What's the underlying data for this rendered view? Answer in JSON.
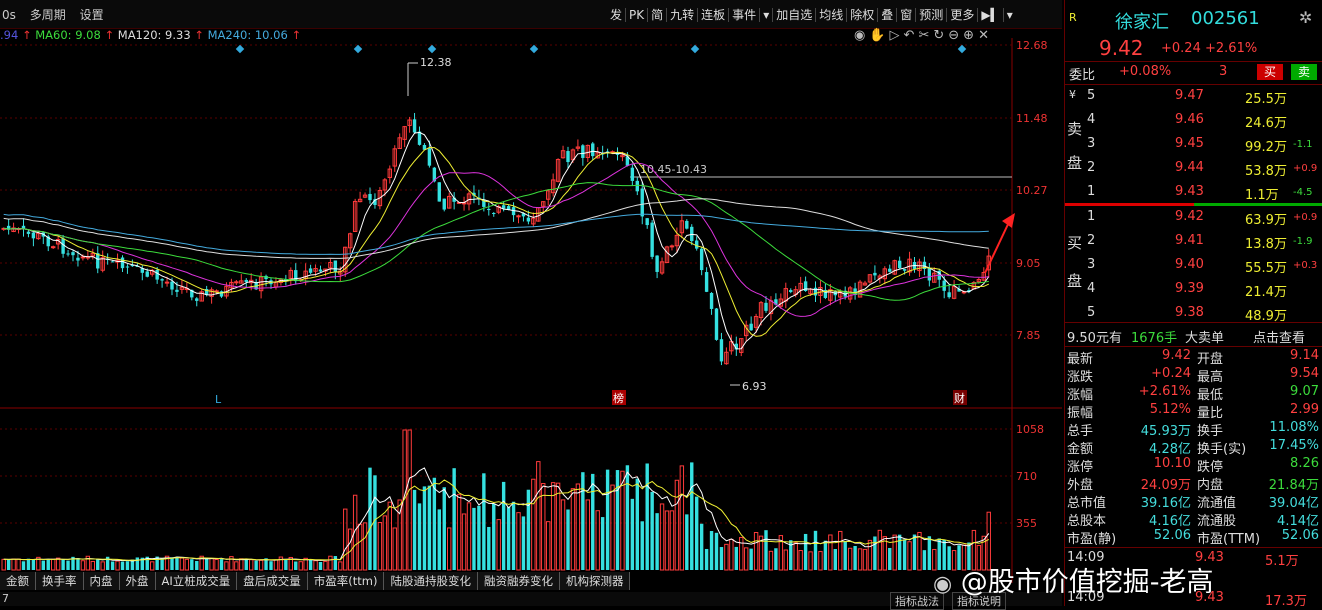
{
  "toolbar": {
    "left_items": [
      "0s",
      "多周期",
      "设置"
    ],
    "right_items": [
      "发",
      "PK",
      "简",
      "九转",
      "连板",
      "事件",
      "加自选",
      "均线",
      "除权",
      "叠",
      "窗",
      "预测",
      "更多"
    ]
  },
  "ma_legend": [
    {
      "text": ".94",
      "color": "#55d"
    },
    {
      "text": "MA60: 9.08",
      "color": "#3cdb3c"
    },
    {
      "text": "MA120: 9.33",
      "color": "#dddddd"
    },
    {
      "text": "MA240: 10.06",
      "color": "#4ad"
    }
  ],
  "chart": {
    "price_axis": [
      "12.68",
      "11.48",
      "10.27",
      "9.05",
      "7.85"
    ],
    "volume_axis": [
      "1058",
      "710",
      "355"
    ],
    "high_label": "12.38",
    "low_label": "6.93",
    "range_label": "10.45-10.43",
    "marks": [
      "L",
      "榜",
      "财"
    ],
    "colors": {
      "up": "#ff3b3b",
      "down": "#35e0e0",
      "grid": "#5a0000"
    }
  },
  "bottom_tabs": [
    "金额",
    "换手率",
    "内盘",
    "外盘",
    "AI立桩成交量",
    "盘后成交量",
    "市盈率(ttm)",
    "陆股通持股变化",
    "融资融券变化",
    "机构探测器"
  ],
  "status": {
    "left": "7",
    "tabs": [
      "指标战法",
      "指标说明"
    ]
  },
  "stock": {
    "badge": "R",
    "name": "徐家汇",
    "code": "002561",
    "price": "9.42",
    "change": "+0.24",
    "change_pct": "+2.61%"
  },
  "weibi": {
    "label": "委比",
    "value": "+0.08%",
    "count": "3",
    "buy": "买",
    "sell": "卖"
  },
  "sell_side_label": [
    "卖",
    "盘"
  ],
  "buy_side_label": [
    "买",
    "盘"
  ],
  "asks": [
    {
      "level": "5",
      "price": "9.47",
      "vol": "25.5万",
      "chg": ""
    },
    {
      "level": "4",
      "price": "9.46",
      "vol": "24.6万",
      "chg": ""
    },
    {
      "level": "3",
      "price": "9.45",
      "vol": "99.2万",
      "chg": "-1.1"
    },
    {
      "level": "2",
      "price": "9.44",
      "vol": "53.8万",
      "chg": "+0.9"
    },
    {
      "level": "1",
      "price": "9.43",
      "vol": "1.1万",
      "chg": "-4.5"
    }
  ],
  "bids": [
    {
      "level": "1",
      "price": "9.42",
      "vol": "63.9万",
      "chg": "+0.9"
    },
    {
      "level": "2",
      "price": "9.41",
      "vol": "13.8万",
      "chg": "-1.9"
    },
    {
      "level": "3",
      "price": "9.40",
      "vol": "55.5万",
      "chg": "+0.3"
    },
    {
      "level": "4",
      "price": "9.39",
      "vol": "21.4万",
      "chg": ""
    },
    {
      "level": "5",
      "price": "9.38",
      "vol": "48.9万",
      "chg": ""
    }
  ],
  "big_order": {
    "price": "9.50元有",
    "vol": "1676手",
    "label": "大卖单",
    "link": "点击查看"
  },
  "stats": [
    [
      "最新",
      "9.42",
      "开盘",
      "9.14"
    ],
    [
      "涨跌",
      "+0.24",
      "最高",
      "9.54"
    ],
    [
      "涨幅",
      "+2.61%",
      "最低",
      "9.07"
    ],
    [
      "振幅",
      "5.12%",
      "量比",
      "2.99"
    ],
    [
      "总手",
      "45.93万",
      "换手",
      "11.08%"
    ],
    [
      "金额",
      "4.28亿",
      "换手(实)",
      "17.45%"
    ],
    [
      "涨停",
      "10.10",
      "跌停",
      "8.26"
    ],
    [
      "外盘",
      "24.09万",
      "内盘",
      "21.84万"
    ],
    [
      "总市值",
      "39.16亿",
      "流通值",
      "39.04亿"
    ],
    [
      "总股本",
      "4.16亿",
      "流通股",
      "4.14亿"
    ],
    [
      "市盈(静)",
      "52.06",
      "市盈(TTM)",
      "52.06"
    ]
  ],
  "ticks": [
    {
      "time": "14:09",
      "price": "9.43",
      "vol": "5.1万"
    },
    {
      "time": "14:09",
      "price": "9.43",
      "vol": "17.3万"
    }
  ],
  "watermark": "@股市价值挖掘-老高"
}
